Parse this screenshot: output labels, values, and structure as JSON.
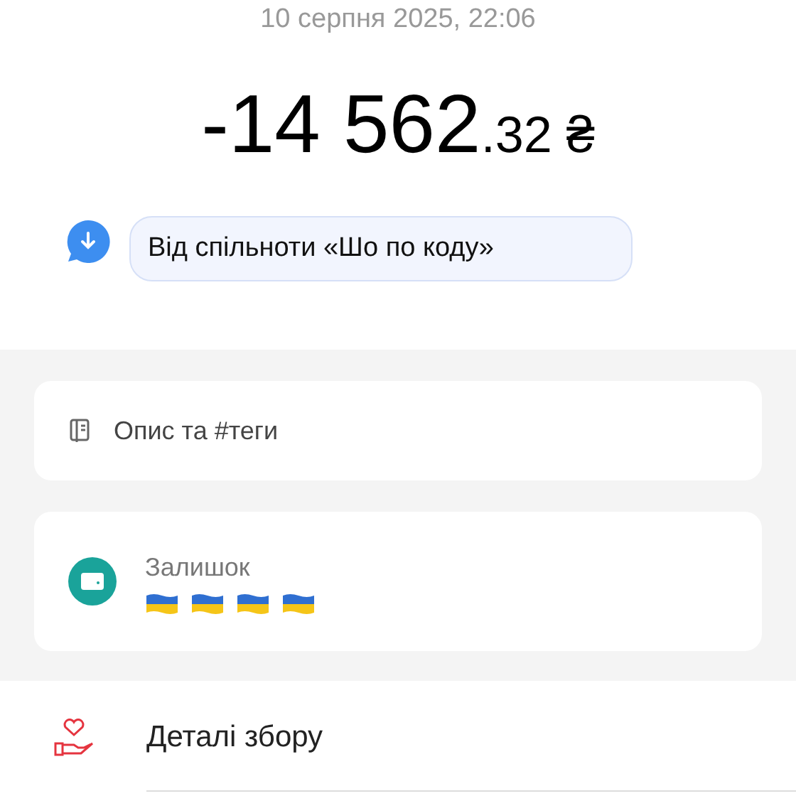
{
  "date": "10 серпня 2025, 22:06",
  "amount": {
    "integer": "-14 562",
    "fraction": ".32",
    "currency": "₴"
  },
  "comment": "Від спільноти «Шо по коду»",
  "cards": [
    {
      "kind": "description",
      "label": "Опис та #теги"
    },
    {
      "kind": "balance",
      "label": "Залишок"
    }
  ],
  "details": "Деталі збору"
}
